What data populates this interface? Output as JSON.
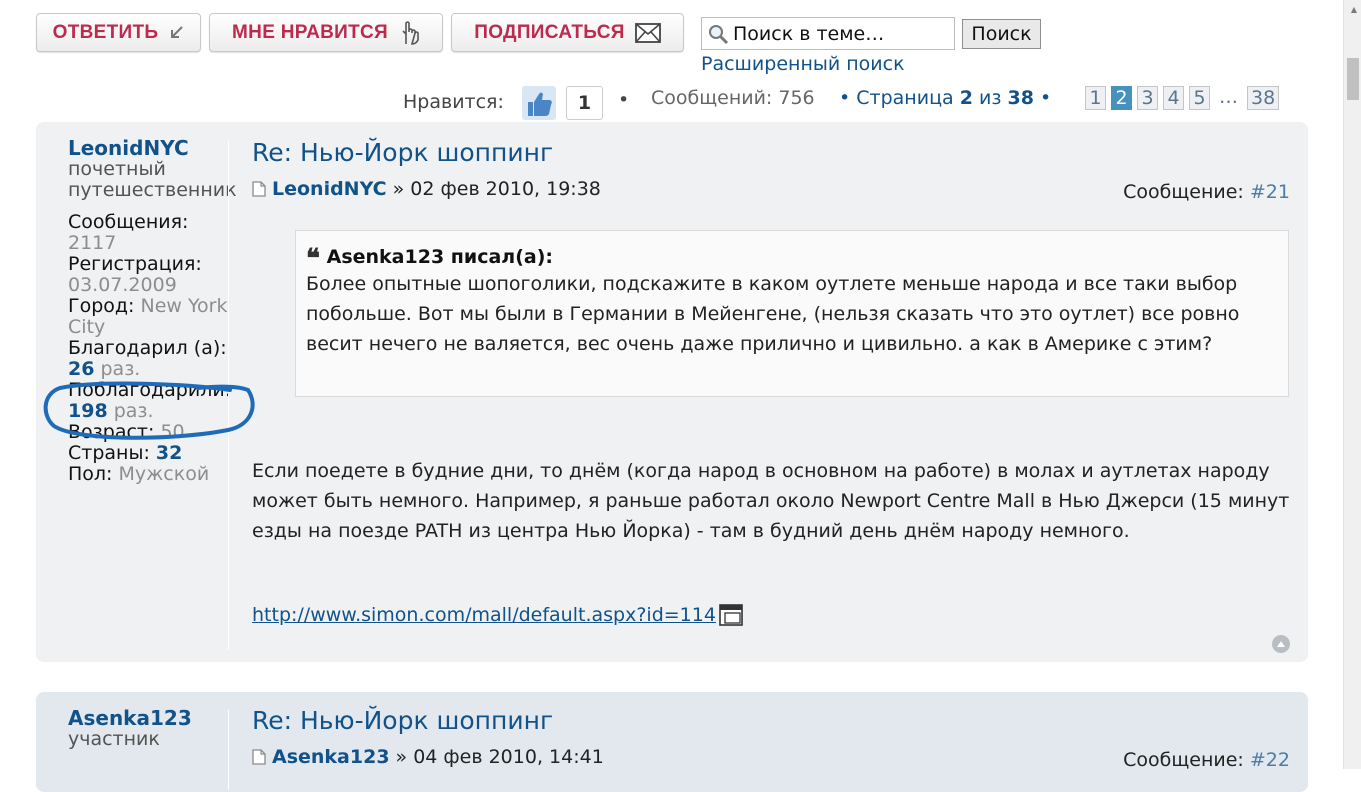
{
  "toolbar": {
    "reply_label": "ОТВЕТИТЬ",
    "like_label": "МНЕ НРАВИТСЯ",
    "subscribe_label": "ПОДПИСАТЬСЯ"
  },
  "search": {
    "placeholder": "Поиск в теме…",
    "button_label": "Поиск",
    "advanced_label": "Расширенный поиск"
  },
  "stats": {
    "likes_label": "Нравится:",
    "likes_count": "1",
    "posts_label": "Сообщений: 756",
    "page_word": "Страница",
    "page_current": "2",
    "page_of": "из",
    "page_total": "38"
  },
  "pagination": {
    "pages": [
      "1",
      "2",
      "3",
      "4",
      "5"
    ],
    "ellipsis": "…",
    "last": "38"
  },
  "posts": [
    {
      "author": "LeonidNYC",
      "rank": "почетный путешественник",
      "messages_label": "Сообщения:",
      "messages_value": "2117",
      "reg_label": "Регистрация:",
      "reg_value": "03.07.2009",
      "city_label": "Город:",
      "city_value": "New York City",
      "thanked_label": "Благодарил (а):",
      "thanked_value": "26",
      "thanked_suffix": "раз.",
      "thanks_received_label": "Поблагодарили:",
      "thanks_received_value": "198",
      "thanks_received_suffix": "раз.",
      "age_label": "Возраст:",
      "age_value": "50",
      "countries_label": "Страны:",
      "countries_value": "32",
      "gender_label": "Пол:",
      "gender_value": "Мужской",
      "title": "Re: Нью-Йорк шоппинг",
      "meta_author": "LeonidNYC",
      "meta_date": "» 02 фев 2010, 19:38",
      "post_label": "Сообщение:",
      "post_number": "#21",
      "quote_author": "Asenka123 писал(а):",
      "quote_text": "Более опытные шопоголики, подскажите в каком оутлете меньше народа и все таки выбор побольше. Вот мы были в Германии в Мейенгене, (нельзя сказать что это оутлет) все ровно весит нечего не валяется, вес очень даже прилично и цивильно. а как в Америке с этим?",
      "body": "Если поедете в будние дни, то днём (когда народ в основном на работе) в молах и аутлетах народу может быть немного. Например, я раньше работал около Newport Centre Mall в Нью Джерси (15 минут езды на поезде PATH из центра Нью Йорка) - там в будний день днём народу немного.",
      "link": "http://www.simon.com/mall/default.aspx?id=114"
    },
    {
      "author": "Asenka123",
      "rank": "участник",
      "title": "Re: Нью-Йорк шоппинг",
      "meta_author": "Asenka123",
      "meta_date": "» 04 фев 2010, 14:41",
      "post_label": "Сообщение:",
      "post_number": "#22"
    }
  ],
  "colors": {
    "accent": "#105289",
    "button_text": "#bc2a4d",
    "annotation": "#1f6bb8",
    "post_bg": "#f0f1f3",
    "post_bg_alt": "#e2e8ee",
    "active_page": "#4692bf"
  },
  "icons": [
    "reply-arrow-icon",
    "hand-pointer-icon",
    "envelope-icon",
    "magnifier-icon",
    "thumbs-up-icon",
    "post-icon",
    "external-link-icon",
    "back-to-top-icon"
  ]
}
